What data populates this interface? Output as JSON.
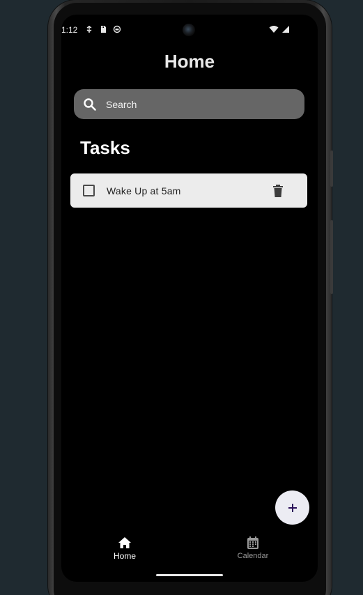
{
  "status_bar": {
    "time": "1:12",
    "icons_left": [
      "usb-debug-icon",
      "sd-card-icon",
      "sync-icon"
    ],
    "icons_right": [
      "wifi-icon",
      "signal-icon"
    ]
  },
  "header": {
    "title": "Home"
  },
  "search": {
    "placeholder": "Search",
    "icon": "search-icon"
  },
  "tasks_section": {
    "heading": "Tasks",
    "items": [
      {
        "label": "Wake Up at 5am",
        "checked": false,
        "delete_icon": "trash-icon"
      }
    ]
  },
  "fab": {
    "icon": "plus-icon",
    "accent": "#2a0f5a"
  },
  "bottom_nav": {
    "items": [
      {
        "label": "Home",
        "icon": "home-icon",
        "active": true
      },
      {
        "label": "Calendar",
        "icon": "calendar-icon",
        "active": false
      }
    ]
  },
  "colors": {
    "background": "#000000",
    "search_bg": "#666666",
    "card_bg": "#ececec",
    "fab_bg": "#ececf3",
    "nav_inactive": "#9a9a9a"
  }
}
